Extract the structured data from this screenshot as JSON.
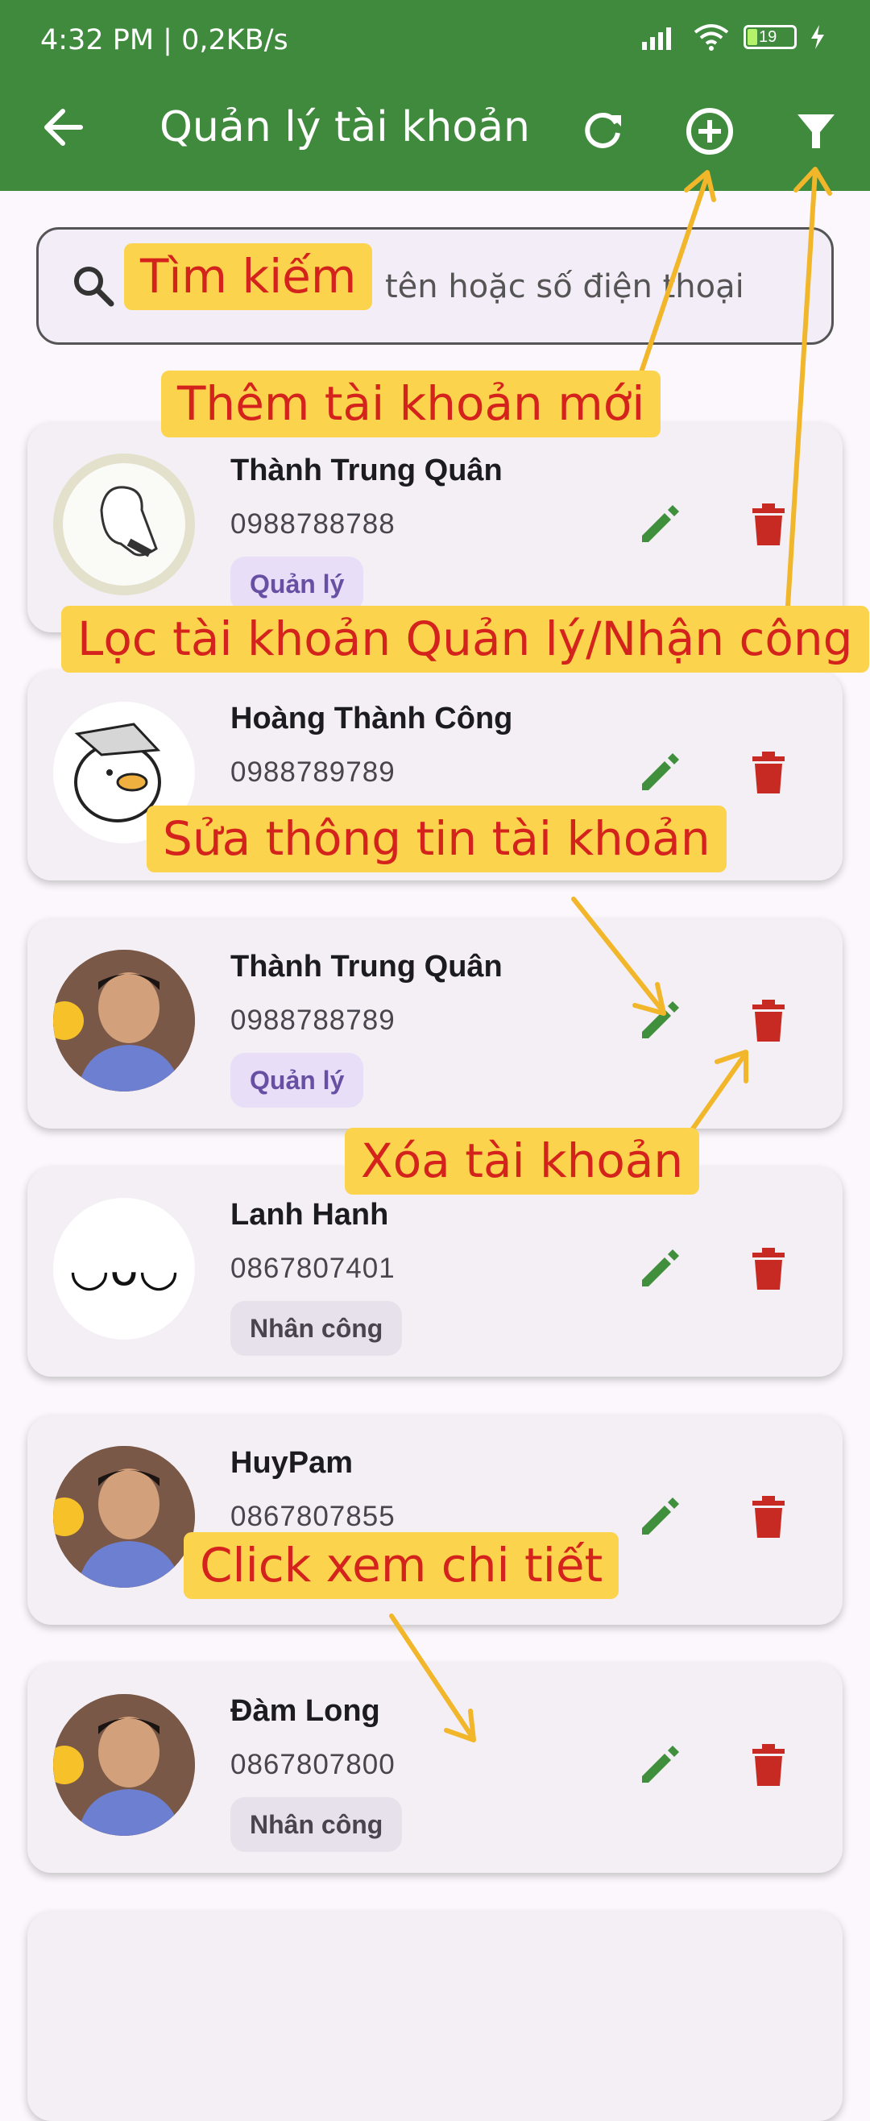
{
  "status": {
    "time": "4:32 PM | 0,2KB/s",
    "battery": "19"
  },
  "appbar": {
    "title": "Quản lý tài khoản"
  },
  "search": {
    "placeholder": "tên hoặc số điện thoại"
  },
  "accounts": [
    {
      "name": "Thành Trung Quân",
      "phone": "0988788788",
      "role": "Quản lý"
    },
    {
      "name": "Hoàng Thành Công",
      "phone": "0988789789",
      "role": ""
    },
    {
      "name": "Thành Trung Quân",
      "phone": "0988788789",
      "role": "Quản lý"
    },
    {
      "name": "Lanh Hanh",
      "phone": "0867807401",
      "role": "Nhân công"
    },
    {
      "name": "HuyPam",
      "phone": "0867807855",
      "role": ""
    },
    {
      "name": "Đàm Long",
      "phone": "0867807800",
      "role": "Nhân công"
    }
  ],
  "annotations": {
    "search": "Tìm kiếm",
    "add": "Thêm tài khoản mới",
    "filter": "Lọc tài khoản Quản lý/Nhận công",
    "edit": "Sửa thông tin tài khoản",
    "delete": "Xóa tài khoản",
    "detail": "Click xem chi tiết"
  },
  "colors": {
    "appbar": "#408a3e",
    "edit": "#3f8f3c",
    "delete": "#c62a22",
    "note_bg": "#fcd34d",
    "note_text": "#d4231c",
    "arrow": "#f2b62a"
  },
  "avatar_emoticon": "◡ᴗ◡"
}
